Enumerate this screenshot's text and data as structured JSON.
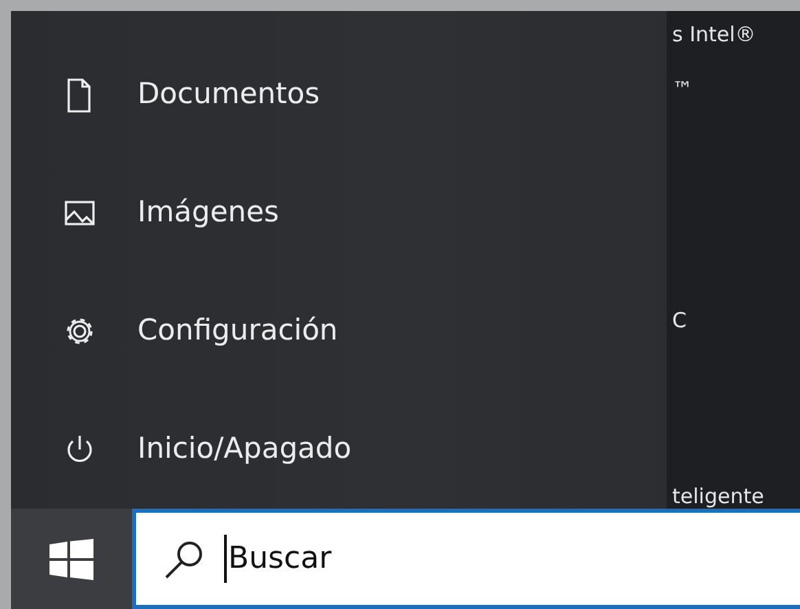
{
  "start_menu": {
    "items": [
      {
        "kind": "document",
        "label": "Documentos"
      },
      {
        "kind": "pictures",
        "label": "Imágenes"
      },
      {
        "kind": "settings",
        "label": "Configuración"
      },
      {
        "kind": "power",
        "label": "Inicio/Apagado"
      }
    ]
  },
  "background_texts": [
    "s Intel®",
    "™",
    "C",
    "teligente"
  ],
  "search": {
    "placeholder": "Buscar"
  }
}
